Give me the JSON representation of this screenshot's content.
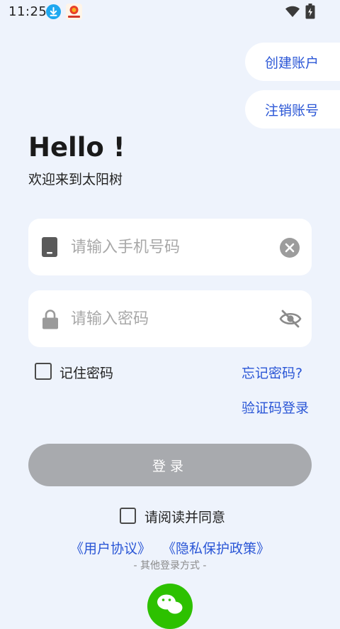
{
  "status_bar": {
    "time": "11:25",
    "icons": [
      "download-icon",
      "app-notification-icon",
      "wifi-icon",
      "battery-charging-icon"
    ]
  },
  "header_actions": {
    "create_account": "创建账户",
    "cancel_account": "注销账号"
  },
  "greeting": {
    "title": "Hello !",
    "subtitle": "欢迎来到太阳树"
  },
  "form": {
    "phone_placeholder": "请输入手机号码",
    "phone_value": "",
    "password_placeholder": "请输入密码",
    "password_value": "",
    "remember_label": "记住密码",
    "remember_checked": false,
    "forgot_password": "忘记密码?",
    "sms_login": "验证码登录",
    "login_button": "登录",
    "icons": [
      "phone-icon",
      "clear-icon",
      "lock-icon",
      "eye-off-icon"
    ]
  },
  "agreement": {
    "agree_label": "请阅读并同意",
    "agree_checked": false,
    "user_agreement": "《用户协议》",
    "privacy_policy": "《隐私保护政策》"
  },
  "other_login": {
    "label": "- 其他登录方式 -",
    "icons": [
      "wechat-icon"
    ]
  },
  "colors": {
    "background": "#eef3fc",
    "link": "#2a56d6",
    "login_button_disabled": "#a8aaae",
    "wechat_green": "#2dc100"
  }
}
